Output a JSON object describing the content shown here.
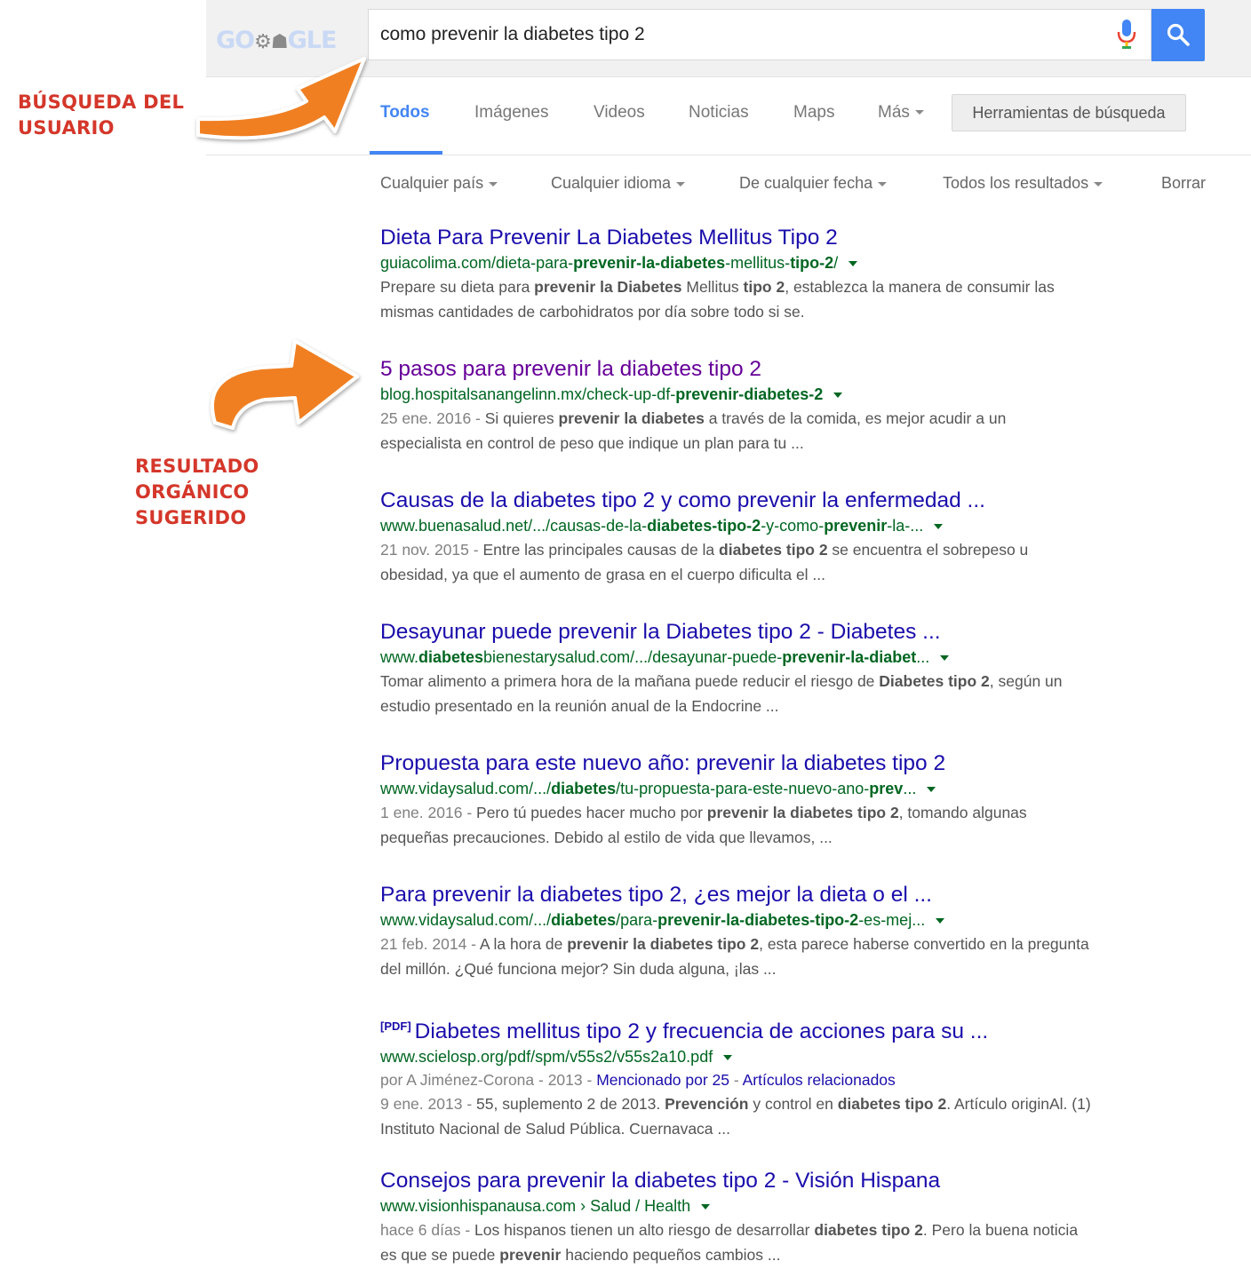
{
  "annotations": {
    "query_label": [
      "BÚSQUEDA DEL",
      "USUARIO"
    ],
    "result_label": [
      "RESULTADO",
      "ORGÁNICO",
      "SUGERIDO"
    ],
    "color": "#d4372a",
    "arrow_color": "#f07f22"
  },
  "header": {
    "logo_text": "GO  GLE",
    "query": "como prevenir la diabetes tipo 2",
    "mic_icon": "microphone-icon",
    "search_icon": "magnifier-icon"
  },
  "tabs": [
    {
      "label": "Todos",
      "active": true
    },
    {
      "label": "Imágenes"
    },
    {
      "label": "Videos"
    },
    {
      "label": "Noticias"
    },
    {
      "label": "Maps"
    },
    {
      "label": "Más"
    }
  ],
  "tools_button": "Herramientas de búsqueda",
  "filters": [
    "Cualquier país",
    "Cualquier idioma",
    "De cualquier fecha",
    "Todos los resultados",
    "Borrar"
  ],
  "results": [
    {
      "title": "Dieta Para Prevenir La Diabetes Mellitus Tipo 2",
      "url_parts": [
        [
          "guiacolima.com/dieta-para-",
          false
        ],
        [
          "prevenir-la-diabetes",
          true
        ],
        [
          "-mellitus-",
          false
        ],
        [
          "tipo-2",
          true
        ],
        [
          "/",
          false
        ]
      ],
      "snippet_parts": [
        [
          "Prepare su dieta para ",
          false
        ],
        [
          "prevenir la Diabetes",
          true
        ],
        [
          " Mellitus ",
          false
        ],
        [
          "tipo 2",
          true
        ],
        [
          ", establezca la manera de consumir las mismas cantidades de carbohidratos por día sobre todo si se.",
          false
        ]
      ]
    },
    {
      "title": "5 pasos para prevenir la diabetes tipo 2",
      "visited": true,
      "url_parts": [
        [
          "blog.hospitalsanangelinn.mx/check-up-df-",
          false
        ],
        [
          "prevenir-diabetes-2",
          true
        ]
      ],
      "date": "25 ene. 2016",
      "snippet_parts": [
        [
          "Si quieres ",
          false
        ],
        [
          "prevenir la diabetes",
          true
        ],
        [
          " a través de la comida, es mejor acudir a un especialista en control de peso que indique un plan para tu ...",
          false
        ]
      ]
    },
    {
      "title": "Causas de la diabetes tipo 2 y como prevenir la enfermedad ...",
      "url_parts": [
        [
          "www.buenasalud.net/.../causas-de-la-",
          false
        ],
        [
          "diabetes-tipo-2",
          true
        ],
        [
          "-y-como-",
          false
        ],
        [
          "prevenir",
          true
        ],
        [
          "-la-...",
          false
        ]
      ],
      "date": "21 nov. 2015",
      "snippet_parts": [
        [
          "Entre las principales causas de la ",
          false
        ],
        [
          "diabetes tipo 2",
          true
        ],
        [
          " se encuentra el sobrepeso u obesidad, ya que el aumento de grasa en el cuerpo dificulta el ...",
          false
        ]
      ]
    },
    {
      "title": "Desayunar puede prevenir la Diabetes tipo 2 - Diabetes ...",
      "url_parts": [
        [
          "www.",
          false
        ],
        [
          "diabetes",
          true
        ],
        [
          "bienestarysalud.com/.../desayunar-puede-",
          false
        ],
        [
          "prevenir-la-diabet",
          true
        ],
        [
          "...",
          false
        ]
      ],
      "snippet_parts": [
        [
          "Tomar alimento a primera hora de la mañana puede reducir el riesgo de ",
          false
        ],
        [
          "Diabetes tipo 2",
          true
        ],
        [
          ", según un estudio presentado en la reunión anual de la Endocrine ...",
          false
        ]
      ]
    },
    {
      "title": "Propuesta para este nuevo año: prevenir la diabetes tipo 2",
      "url_parts": [
        [
          "www.vidaysalud.com/.../",
          false
        ],
        [
          "diabetes",
          true
        ],
        [
          "/tu-propuesta-para-este-nuevo-ano-",
          false
        ],
        [
          "prev",
          true
        ],
        [
          "...",
          false
        ]
      ],
      "date": "1 ene. 2016",
      "snippet_parts": [
        [
          "Pero tú puedes hacer mucho por ",
          false
        ],
        [
          "prevenir la diabetes tipo 2",
          true
        ],
        [
          ", tomando algunas pequeñas precauciones. Debido al estilo de vida que llevamos, ...",
          false
        ]
      ]
    },
    {
      "title": "Para prevenir la diabetes tipo 2, ¿es mejor la dieta o el ...",
      "url_parts": [
        [
          "www.vidaysalud.com/.../",
          false
        ],
        [
          "diabetes",
          true
        ],
        [
          "/para-",
          false
        ],
        [
          "prevenir-la-diabetes-tipo-2",
          true
        ],
        [
          "-es-mej...",
          false
        ]
      ],
      "date": "21 feb. 2014",
      "snippet_parts": [
        [
          "A la hora de ",
          false
        ],
        [
          "prevenir la diabetes tipo 2",
          true
        ],
        [
          ", esta parece haberse convertido en la pregunta del millón. ¿Qué funciona mejor? Sin duda alguna, ¡las ...",
          false
        ]
      ]
    },
    {
      "title": "Diabetes mellitus tipo 2 y frecuencia de acciones para su ...",
      "pdf_tag": "[PDF]",
      "url_parts": [
        [
          "www.scielosp.org/pdf/spm/v55s2/v55s2a10.pdf",
          false
        ]
      ],
      "meta": {
        "author": "por A Jiménez-Corona - 2013 - ",
        "cited": "Mencionado por 25",
        "sep": " - ",
        "related": "Artículos relacionados"
      },
      "date": "9 ene. 2013",
      "snippet_parts": [
        [
          "55, suplemento 2 de 2013. ",
          false
        ],
        [
          "Prevención",
          true
        ],
        [
          " y control en ",
          false
        ],
        [
          "diabetes tipo 2",
          true
        ],
        [
          ". Artículo originAl. (1) Instituto Nacional de Salud Pública. Cuernavaca ...",
          false
        ]
      ]
    },
    {
      "title": "Consejos para prevenir la diabetes tipo 2 - Visión Hispana",
      "url_parts": [
        [
          "www.visionhispanausa.com › Salud / Health",
          false
        ]
      ],
      "date": "hace 6 días",
      "snippet_parts": [
        [
          "Los hispanos tienen un alto riesgo de desarrollar ",
          false
        ],
        [
          "diabetes tipo 2",
          true
        ],
        [
          ". Pero la buena noticia es que se puede ",
          false
        ],
        [
          "prevenir",
          true
        ],
        [
          " haciendo pequeños cambios ...",
          false
        ]
      ]
    }
  ]
}
